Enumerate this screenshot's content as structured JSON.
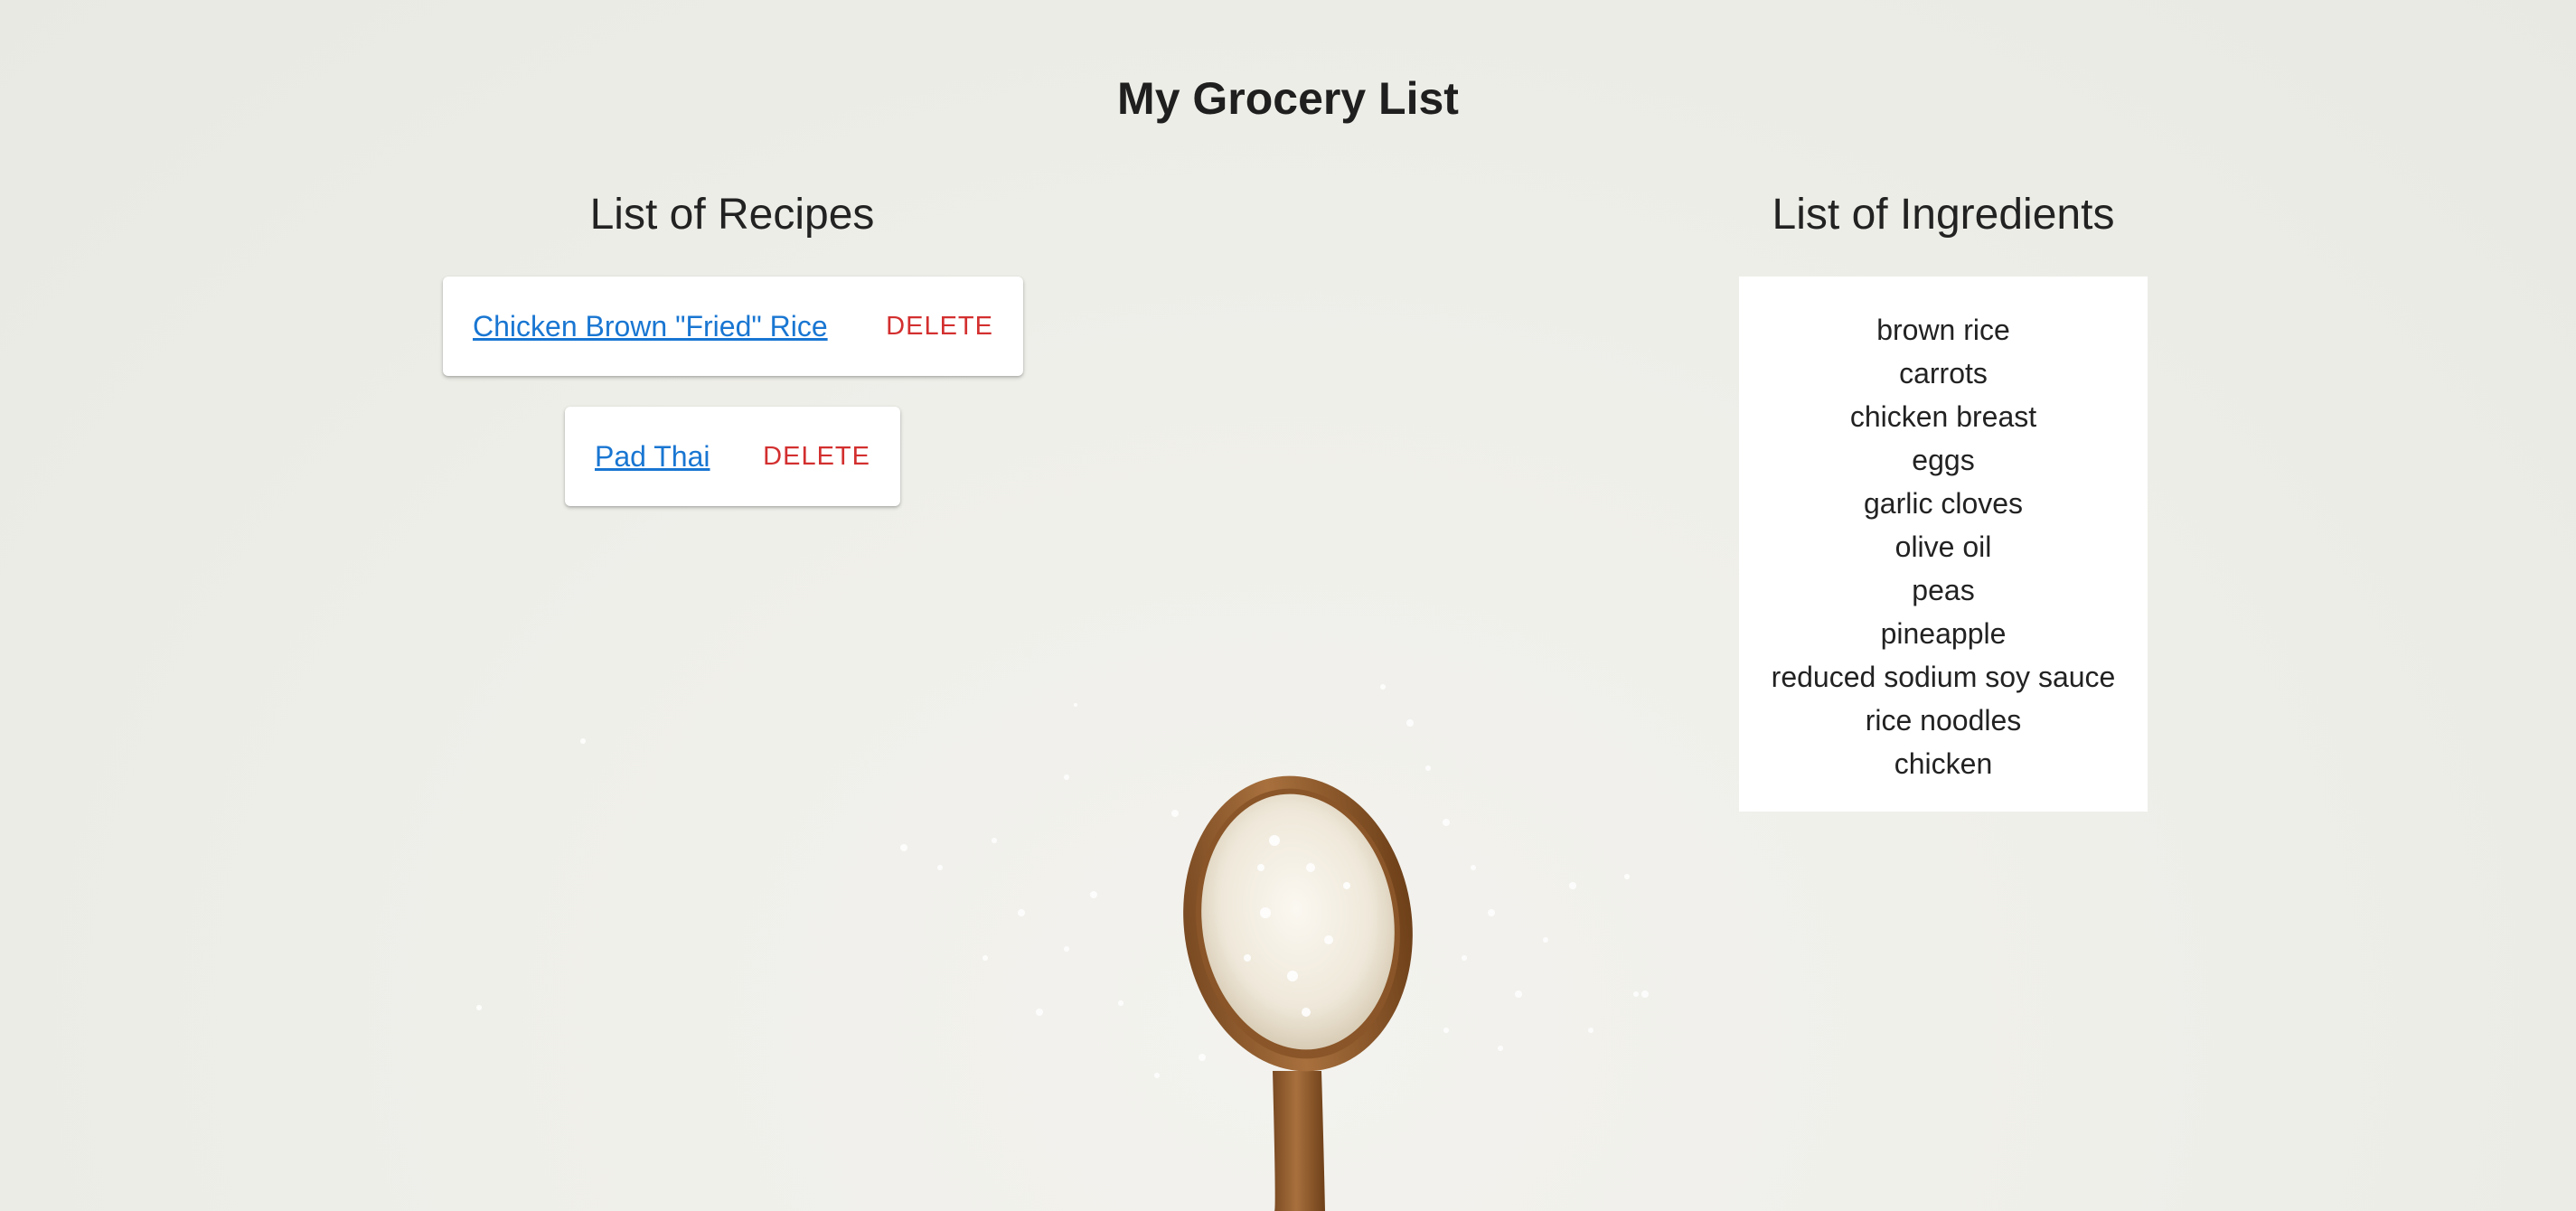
{
  "page": {
    "title": "My Grocery List"
  },
  "recipes": {
    "heading": "List of Recipes",
    "items": [
      {
        "name": "Chicken Brown \"Fried\" Rice",
        "delete_label": "DELETE"
      },
      {
        "name": "Pad Thai",
        "delete_label": "DELETE"
      }
    ]
  },
  "ingredients": {
    "heading": "List of Ingredients",
    "items": [
      "brown rice",
      "carrots",
      "chicken breast",
      "eggs",
      "garlic cloves",
      "olive oil",
      "peas",
      "pineapple",
      "reduced sodium soy sauce",
      "rice noodles",
      "chicken"
    ]
  },
  "theme": {
    "link_color": "#1976d2",
    "delete_color": "#d32f2f",
    "background_color": "#efefea"
  },
  "background": {
    "illustration": "wooden-spoon-with-rice-icon"
  }
}
